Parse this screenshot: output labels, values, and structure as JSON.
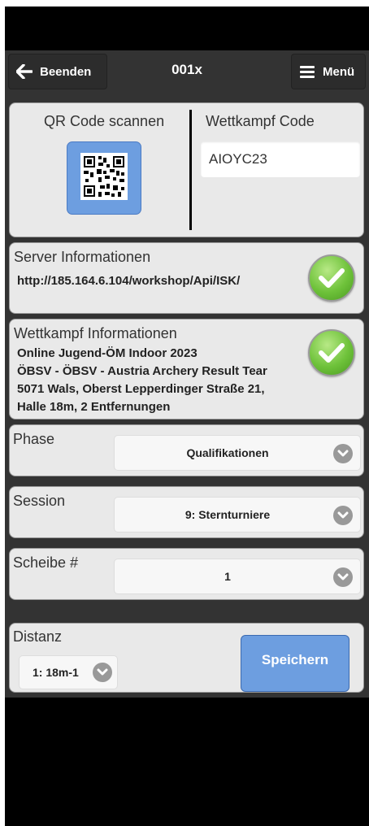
{
  "header": {
    "back_label": "Beenden",
    "title": "001x",
    "menu_label": "Menü"
  },
  "qr": {
    "scan_label": "QR Code scannen",
    "code_label": "Wettkampf Code",
    "code_value": "AIOYC23"
  },
  "server": {
    "title": "Server Informationen",
    "url": "http://185.164.6.104/workshop/Api/ISK/",
    "status": "ok"
  },
  "competition": {
    "title": "Wettkampf Informationen",
    "line1": "Online Jugend-ÖM Indoor 2023",
    "line2": "ÖBSV - ÖBSV - Austria Archery Result Tear",
    "line3": "5071 Wals, Oberst Lepperdinger Straße 21,",
    "line4": "Halle 18m, 2 Entfernungen",
    "status": "ok"
  },
  "phase": {
    "label": "Phase",
    "value": "Qualifikationen"
  },
  "session": {
    "label": "Session",
    "value": "9: Sternturniere"
  },
  "target": {
    "label": "Scheibe #",
    "value": "1"
  },
  "distance": {
    "label": "Distanz",
    "value": "1: 18m-1"
  },
  "save_label": "Speichern",
  "colors": {
    "accent_blue": "#6d9ee0",
    "success_green": "#6ec23a",
    "panel_bg": "#e9e9e9",
    "app_bg": "#333333"
  }
}
